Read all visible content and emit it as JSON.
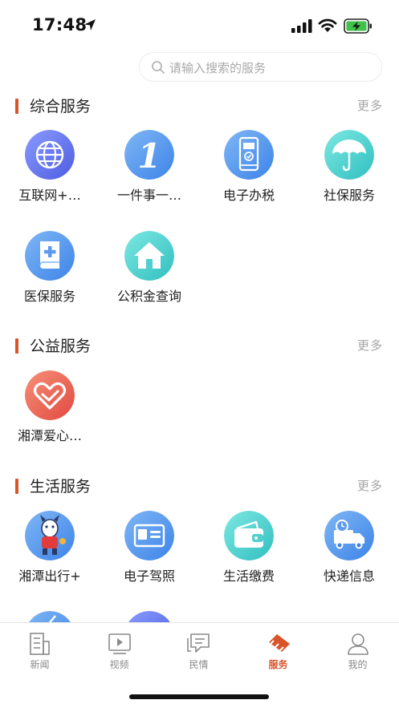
{
  "status_bar": {
    "time": "17:48",
    "icons": [
      "location-arrow-icon",
      "cellular-signal-icon",
      "wifi-icon",
      "battery-charging-icon"
    ]
  },
  "search": {
    "placeholder": "请输入搜索的服务"
  },
  "sections": [
    {
      "title": "综合服务",
      "more": "更多",
      "items": [
        {
          "label": "互联网+…",
          "icon": "globe-icon"
        },
        {
          "label": "一件事一…",
          "icon": "number-one-icon"
        },
        {
          "label": "电子办税",
          "icon": "tax-phone-icon"
        },
        {
          "label": "社保服务",
          "icon": "umbrella-icon"
        },
        {
          "label": "医保服务",
          "icon": "medical-book-icon"
        },
        {
          "label": "公积金查询",
          "icon": "house-icon"
        }
      ]
    },
    {
      "title": "公益服务",
      "more": "更多",
      "items": [
        {
          "label": "湘潭爱心…",
          "icon": "heart-hand-icon"
        }
      ]
    },
    {
      "title": "生活服务",
      "more": "更多",
      "items": [
        {
          "label": "湘潭出行+",
          "icon": "mascot-icon"
        },
        {
          "label": "电子驾照",
          "icon": "id-card-icon"
        },
        {
          "label": "生活缴费",
          "icon": "wallet-icon"
        },
        {
          "label": "快递信息",
          "icon": "delivery-truck-icon"
        }
      ]
    }
  ],
  "tab_bar": {
    "active_color": "#d8542b",
    "tabs": [
      {
        "label": "新闻",
        "icon": "news-icon",
        "active": false
      },
      {
        "label": "视频",
        "icon": "video-icon",
        "active": false
      },
      {
        "label": "民情",
        "icon": "chat-icon",
        "active": false
      },
      {
        "label": "服务",
        "icon": "service-icon",
        "active": true
      },
      {
        "label": "我的",
        "icon": "profile-icon",
        "active": false
      }
    ]
  },
  "colors": {
    "accent": "#d8542b",
    "blue_gradient": [
      "#7fb6f5",
      "#3d84e8"
    ],
    "teal_gradient": [
      "#7ee8e2",
      "#30bfc0"
    ],
    "red_gradient": [
      "#f6907a",
      "#e1493f"
    ],
    "purple_gradient": [
      "#8a9bff",
      "#4d5ce0"
    ]
  }
}
